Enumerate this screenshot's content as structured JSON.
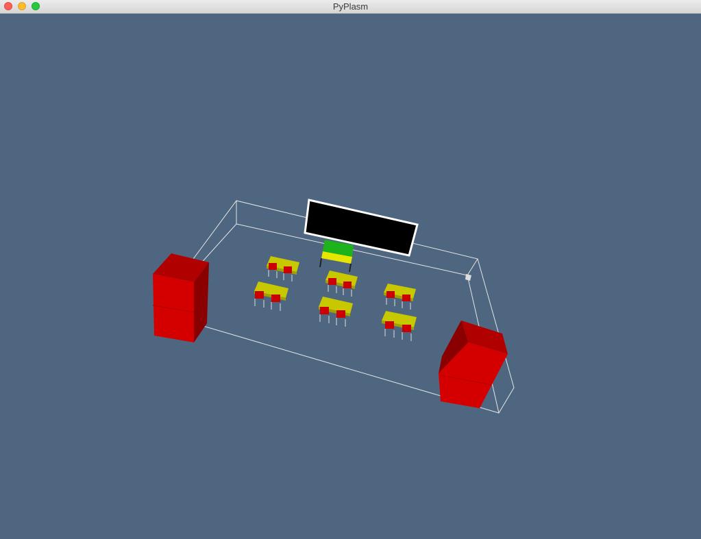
{
  "window": {
    "title": "PyPlasm",
    "controls": [
      "close",
      "minimize",
      "zoom"
    ]
  },
  "viewport": {
    "background_color": "#4f6680",
    "scene": {
      "description_icon": "3d-classroom-model",
      "colors": {
        "cabinet": "#d40000",
        "cabinet_top": "#b00000",
        "cabinet_side": "#8a0000",
        "desk": "#c8c800",
        "chair": "#cc0000",
        "teacher_desk_top": "#1db31d",
        "teacher_desk_front": "#e6e600",
        "blackboard": "#000000",
        "wireframe": "#e6e6e6"
      },
      "student_desk_count": 6,
      "cabinet_count": 2
    }
  }
}
